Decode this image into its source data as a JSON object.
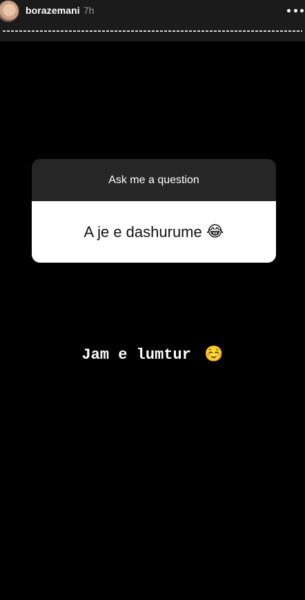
{
  "header": {
    "username": "borazemani",
    "time": "7h",
    "more_icon": "more-horizontal-icon",
    "avatar_icon": "profile-avatar"
  },
  "question_sticker": {
    "title": "Ask me a question",
    "question": "A je e dashurume",
    "question_emoji": "😂"
  },
  "answer": {
    "text": "Jam e lumtur",
    "emoji": "☺️"
  },
  "colors": {
    "background": "#000000",
    "header_bg": "#1b1b1b",
    "card_header_bg": "#262626",
    "card_body_bg": "#ffffff"
  }
}
